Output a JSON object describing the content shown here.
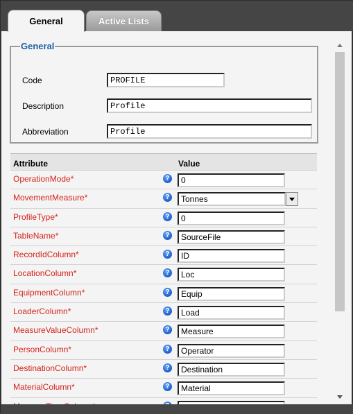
{
  "tabs": [
    {
      "label": "General",
      "active": true
    },
    {
      "label": "Active Lists",
      "active": false
    }
  ],
  "general": {
    "legend": "General",
    "fields": [
      {
        "label": "Code",
        "value": "PROFILE"
      },
      {
        "label": "Description",
        "value": "Profile"
      },
      {
        "label": "Abbreviation",
        "value": "Profile"
      }
    ]
  },
  "grid": {
    "headers": {
      "attribute": "Attribute",
      "value": "Value"
    },
    "rows": [
      {
        "attribute": "OperationMode*",
        "value": "0"
      },
      {
        "attribute": "MovementMeasure*",
        "value": "Tonnes",
        "type": "select"
      },
      {
        "attribute": "ProfileType*",
        "value": "0"
      },
      {
        "attribute": "TableName*",
        "value": "SourceFile"
      },
      {
        "attribute": "RecordIdColumn*",
        "value": "ID"
      },
      {
        "attribute": "LocationColumn*",
        "value": "Loc"
      },
      {
        "attribute": "EquipmentColumn*",
        "value": "Equip"
      },
      {
        "attribute": "LoaderColumn*",
        "value": "Load"
      },
      {
        "attribute": "MeasureValueColumn*",
        "value": "Measure"
      },
      {
        "attribute": "PersonColumn*",
        "value": "Operator"
      },
      {
        "attribute": "DestinationColumn*",
        "value": "Destination"
      },
      {
        "attribute": "MaterialColumn*",
        "value": "Material"
      },
      {
        "attribute": "MeasureTimeColumn*",
        "value": ""
      }
    ]
  },
  "colors": {
    "required_label": "#d4241a",
    "legend": "#1f5fa8",
    "help_icon": "#1b5cc8"
  },
  "icons": {
    "help": "question-mark-icon",
    "dropdown": "chevron-down-icon"
  }
}
